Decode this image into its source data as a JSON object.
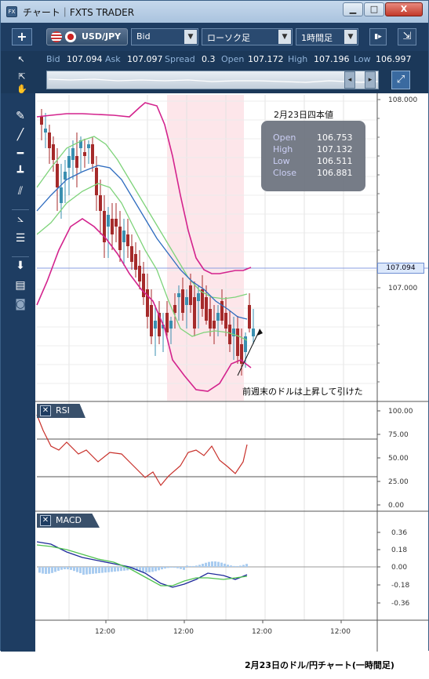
{
  "window": {
    "title": "チャート｜FXTS TRADER",
    "app_icon": "FX",
    "minimize": "▁",
    "maximize": "□",
    "close": "X"
  },
  "toolbar": {
    "add_icon": "+",
    "pair": "USD/JPY",
    "price_type": "Bid",
    "chart_type": "ローソク足",
    "timeframe": "1時間足",
    "dropdown_arrow": "▼",
    "extra_icon": "▮▸",
    "collapse_icon": "⇲"
  },
  "quote": {
    "bid_label": "Bid",
    "bid": "107.094",
    "ask_label": "Ask",
    "ask": "107.097",
    "spread_label": "Spread",
    "spread": "0.3",
    "open_label": "Open",
    "open": "107.172",
    "high_label": "High",
    "high": "107.196",
    "low_label": "Low",
    "low": "106.997"
  },
  "navigator": {
    "left_arrow": "◂",
    "right_arrow": "▸",
    "handle": "⇔",
    "zoom_icon": "⤢"
  },
  "left_tools": [
    "cursor",
    "crosshair",
    "hand",
    "draw",
    "line",
    "hline",
    "vline",
    "channel",
    "fib-fan",
    "fib-retracement",
    "download",
    "template",
    "camera"
  ],
  "ohlc_box": {
    "title": "2月23日四本値",
    "rows": [
      {
        "k": "Open",
        "v": "106.753"
      },
      {
        "k": "High",
        "v": "107.132"
      },
      {
        "k": "Low",
        "v": "106.511"
      },
      {
        "k": "Close",
        "v": "106.881"
      }
    ]
  },
  "current_price": "107.094",
  "annotation": "前週末のドルは上昇して引けた",
  "rsi": {
    "label": "RSI",
    "ticks": [
      "100.00",
      "75.00",
      "50.00",
      "25.00",
      "0.00"
    ]
  },
  "macd": {
    "label": "MACD",
    "ticks": [
      "0.36",
      "0.18",
      "0.00",
      "-0.18",
      "-0.36"
    ]
  },
  "price_axis": {
    "ticks": [
      "108.000",
      "107.000"
    ]
  },
  "time_axis": {
    "ticks": [
      "12:00",
      "12:00",
      "12:00",
      "12:00"
    ]
  },
  "caption": "2月23日のドル/円チャート(一時間足)",
  "colors": {
    "bull": "#3a8fb0",
    "bear": "#a52a2a",
    "bb_outer": "#d3238d",
    "bb_inner": "#7ed37a",
    "ma": "#2d6bbf",
    "rsi_line": "#c8302a",
    "highlight": "#fde6ea",
    "macd_hist": "#a9ccf0",
    "macd_line": "#1e2a9a",
    "signal_line": "#4fc24f"
  }
}
